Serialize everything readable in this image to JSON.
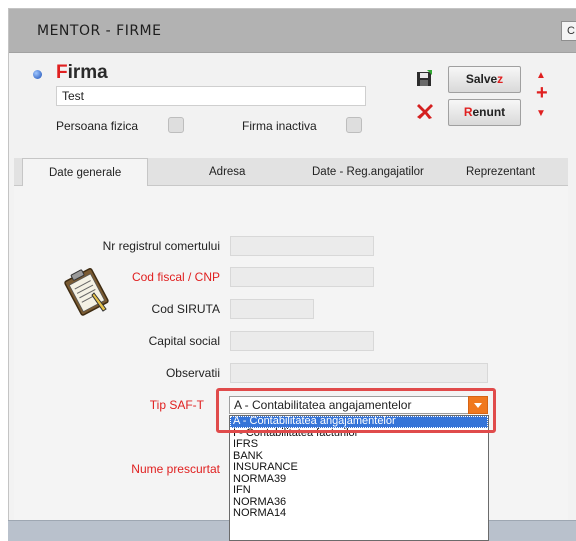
{
  "window": {
    "title": "MENTOR - FIRME",
    "corner_button": "C"
  },
  "firma": {
    "title_first": "F",
    "title_rest": "irma",
    "name_value": "Test"
  },
  "checkboxes": [
    {
      "label": "Persoana fizica",
      "checked": false
    },
    {
      "label": "Firma inactiva",
      "checked": false
    }
  ],
  "actions": {
    "save_first": "Salve",
    "save_hot": "z",
    "cancel_hot": "R",
    "cancel_rest": "enunt"
  },
  "tabs": [
    "Date generale",
    "Adresa",
    "Date - Reg.angajatilor",
    "Reprezentant"
  ],
  "fields": {
    "nr_registru": "Nr registrul comertului",
    "cod_fiscal": "Cod fiscal / CNP",
    "cod_siruta": "Cod SIRUTA",
    "capital_social": "Capital social",
    "observatii": "Observatii",
    "tip_saft": "Tip SAF-T",
    "nume_prescurtat": "Nume prescurtat"
  },
  "saft_select": {
    "value": "A - Contabilitatea angajamentelor"
  },
  "saft_options": [
    "A - Contabilitatea angajamentelor",
    "I - Contabilitatea facturilor",
    "IFRS",
    "BANK",
    "INSURANCE",
    "NORMA39",
    "IFN",
    "NORMA36",
    "NORMA14"
  ],
  "colors": {
    "accent_red": "#e02020",
    "highlight": "#e04b4b",
    "select_blue": "#3574d8",
    "dropdown_orange": "#f0781e"
  }
}
